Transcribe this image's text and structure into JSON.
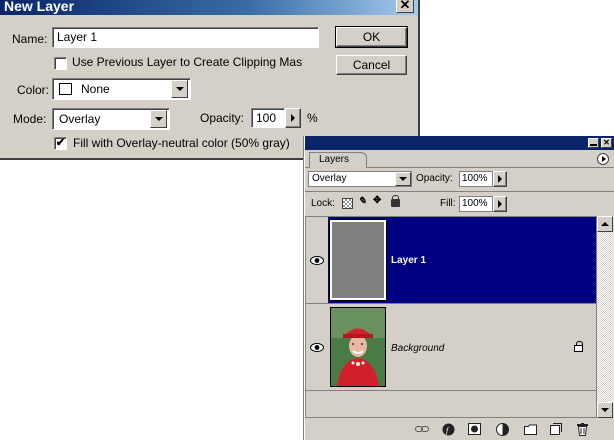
{
  "dialog": {
    "title": "New Layer",
    "close_glyph": "✕",
    "name_label": "Name:",
    "name_value": "Layer 1",
    "clipping_label": "Use Previous Layer to Create Clipping Mask",
    "clipping_checked": false,
    "color_label": "Color:",
    "color_value": "None",
    "mode_label": "Mode:",
    "mode_value": "Overlay",
    "opacity_label": "Opacity:",
    "opacity_value": "100",
    "percent": "%",
    "fill_label": "Fill with Overlay-neutral color (50% gray)",
    "fill_checked": true,
    "check_glyph": "✔",
    "ok_label": "OK",
    "cancel_label": "Cancel"
  },
  "palette": {
    "tab_label": "Layers",
    "blend_mode": "Overlay",
    "opacity_label": "Opacity:",
    "opacity_value": "100%",
    "lock_label": "Lock:",
    "fill_label": "Fill:",
    "fill_value": "100%",
    "layers": [
      {
        "name": "Layer 1",
        "selected": true,
        "visible": true,
        "locked": false
      },
      {
        "name": "Background",
        "selected": false,
        "visible": true,
        "locked": true
      }
    ]
  },
  "colors": {
    "selection": "#000080",
    "titlebar": "#0a246a",
    "face": "#d4d0c8",
    "gray_thumb": "#808080"
  }
}
